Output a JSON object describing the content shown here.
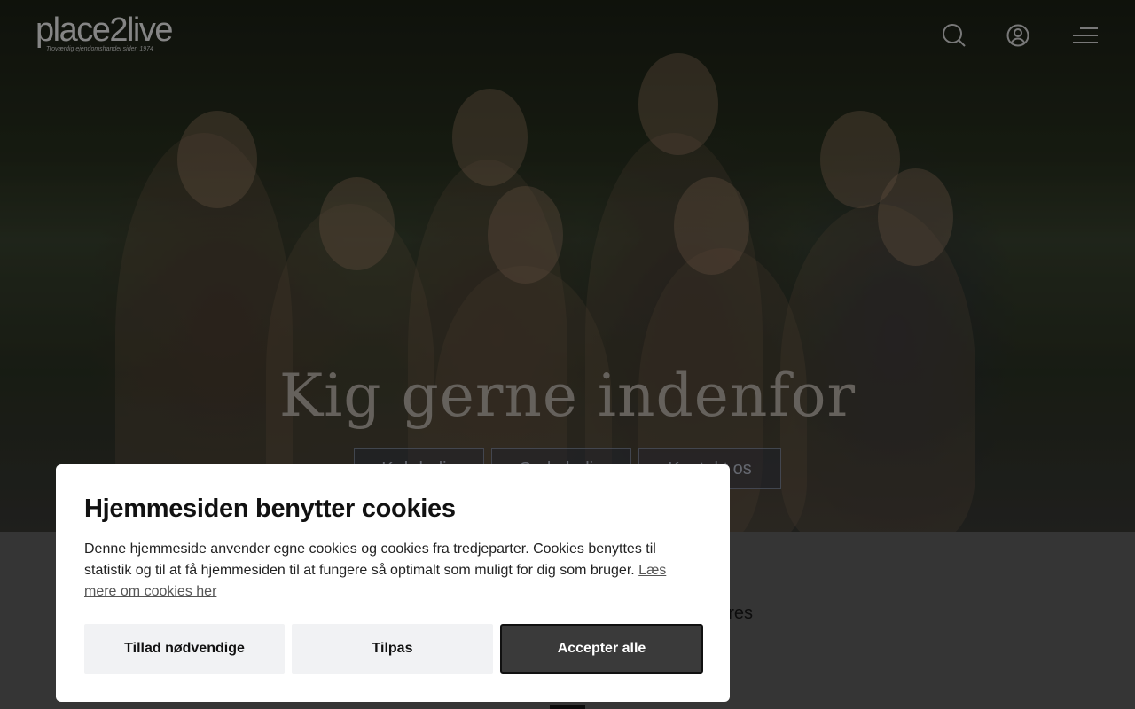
{
  "header": {
    "logo_text": "place2live",
    "logo_tagline": "Troværdig ejendomshandel siden 1974",
    "icons": [
      "search-icon",
      "user-icon",
      "menu-icon"
    ]
  },
  "hero": {
    "title": "Kig gerne indenfor",
    "buttons": [
      {
        "label": "Køb bolig"
      },
      {
        "label": "Sælg bolig"
      },
      {
        "label": "Kontakt os"
      }
    ]
  },
  "below": {
    "text": "der og ikke ere på jeres"
  },
  "cookie_modal": {
    "title": "Hjemmesiden benytter cookies",
    "body": "Denne hjemmeside anvender egne cookies og cookies fra tredjeparter. Cookies benyttes til statistik og til at få hjemmesiden til at fungere så optimalt som muligt for dig som bruger.",
    "link": "Læs mere om cookies her",
    "buttons": {
      "necessary": "Tillad nødvendige",
      "customize": "Tilpas",
      "accept_all": "Accepter alle"
    }
  },
  "colors": {
    "accept_button": "#3a3a3a",
    "secondary_button": "#f1f2f4"
  }
}
